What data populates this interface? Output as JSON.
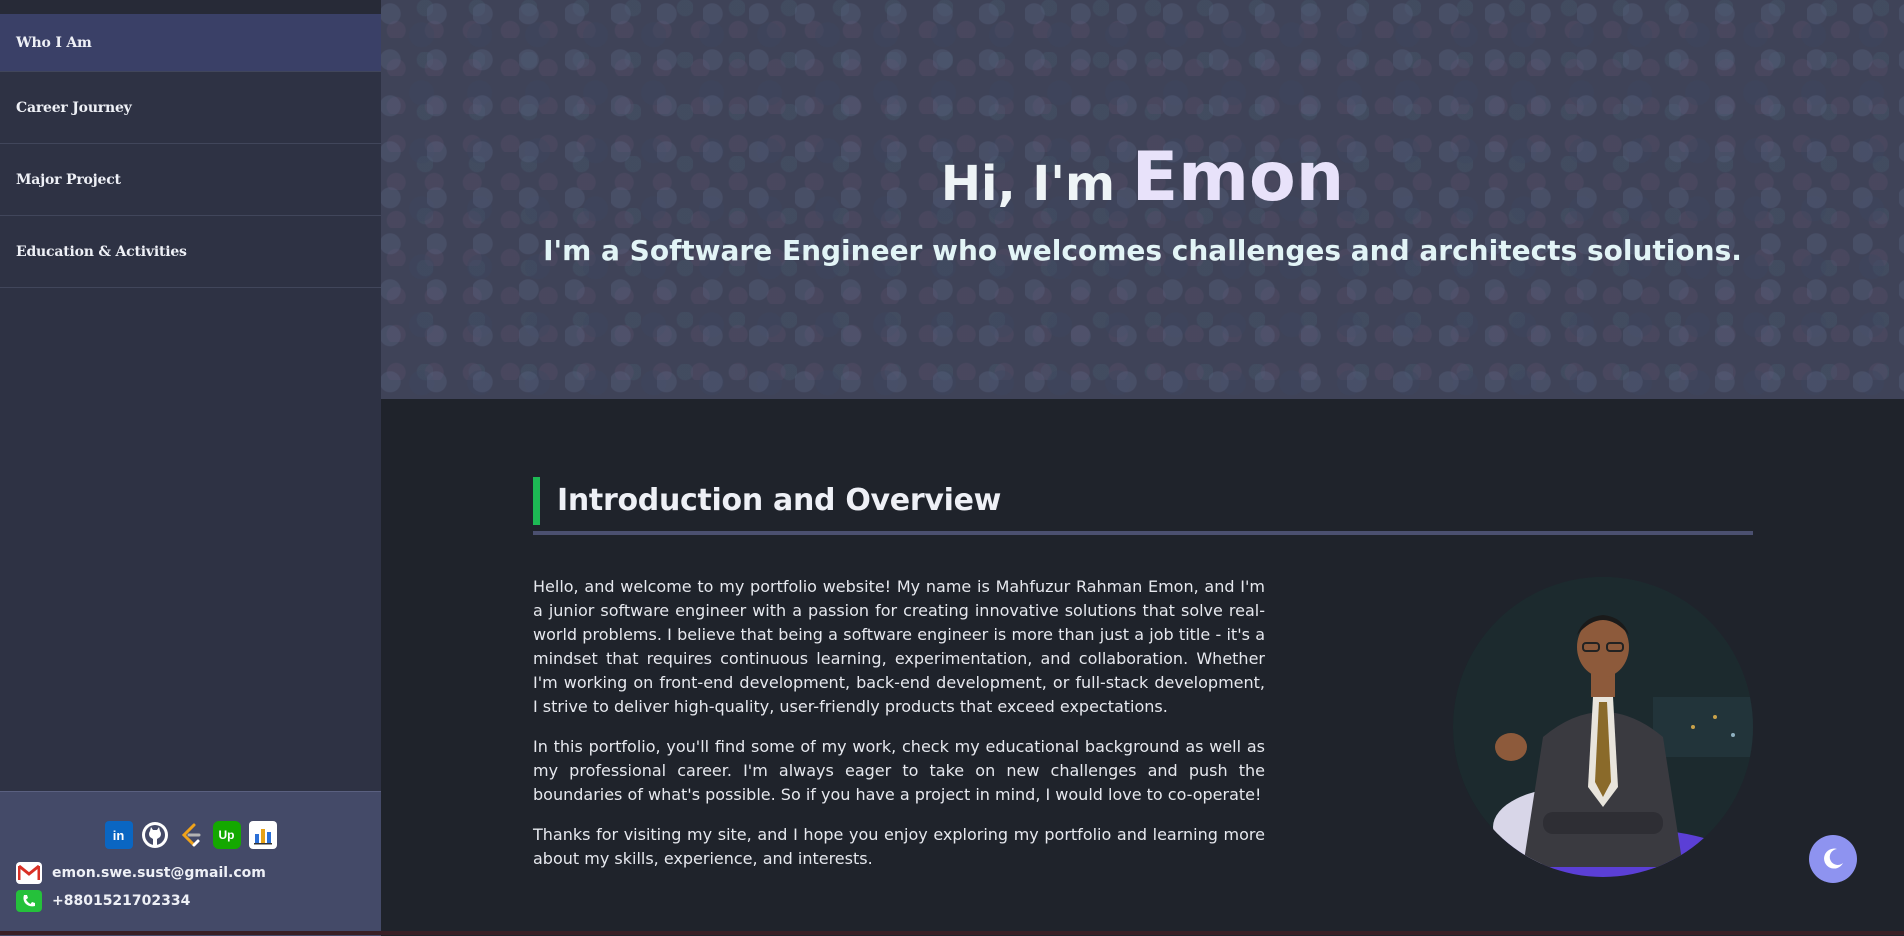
{
  "sidebar": {
    "items": [
      {
        "label": "Who I Am",
        "active": true
      },
      {
        "label": "Career Journey",
        "active": false
      },
      {
        "label": "Major Project",
        "active": false
      },
      {
        "label": "Education & Activities",
        "active": false
      }
    ],
    "social": [
      {
        "icon": "linkedin-icon",
        "text": "in",
        "color": "#0a66c2"
      },
      {
        "icon": "github-icon",
        "text": "",
        "color": "#ffffff"
      },
      {
        "icon": "leetcode-icon",
        "text": "",
        "color": "#f2f2f2"
      },
      {
        "icon": "upwork-icon",
        "text": "Up",
        "color": "#14a800"
      },
      {
        "icon": "chart-icon",
        "text": "",
        "color": "#ffffff"
      }
    ],
    "email": "emon.swe.sust@gmail.com",
    "phone": "+8801521702334"
  },
  "hero": {
    "greeting": "Hi, I'm",
    "name": "Emon",
    "subtitle": "I'm a Software Engineer who welcomes challenges and architects solutions."
  },
  "intro": {
    "heading": "Introduction and Overview",
    "paragraphs": [
      "Hello, and welcome to my portfolio website! My name is Mahfuzur Rahman Emon, and I'm a junior software engineer with a passion for creating innovative solutions that solve real-world problems. I believe that being a software engineer is more than just a job title - it's a mindset that requires continuous learning, experimentation, and collaboration. Whether I'm working on front-end development, back-end development, or full-stack development, I strive to deliver high-quality, user-friendly products that exceed expectations.",
      "In this portfolio, you'll find some of my work, check my educational background as well as my professional career. I'm always eager to take on new challenges and push the boundaries of what's possible. So if you have a project in mind, I would love to co-operate!",
      "Thanks for visiting my site, and I hope you enjoy exploring my portfolio and learning more about my skills, experience, and interests."
    ]
  },
  "colors": {
    "accent": "#1db954",
    "toggle": "#8e93f0"
  }
}
